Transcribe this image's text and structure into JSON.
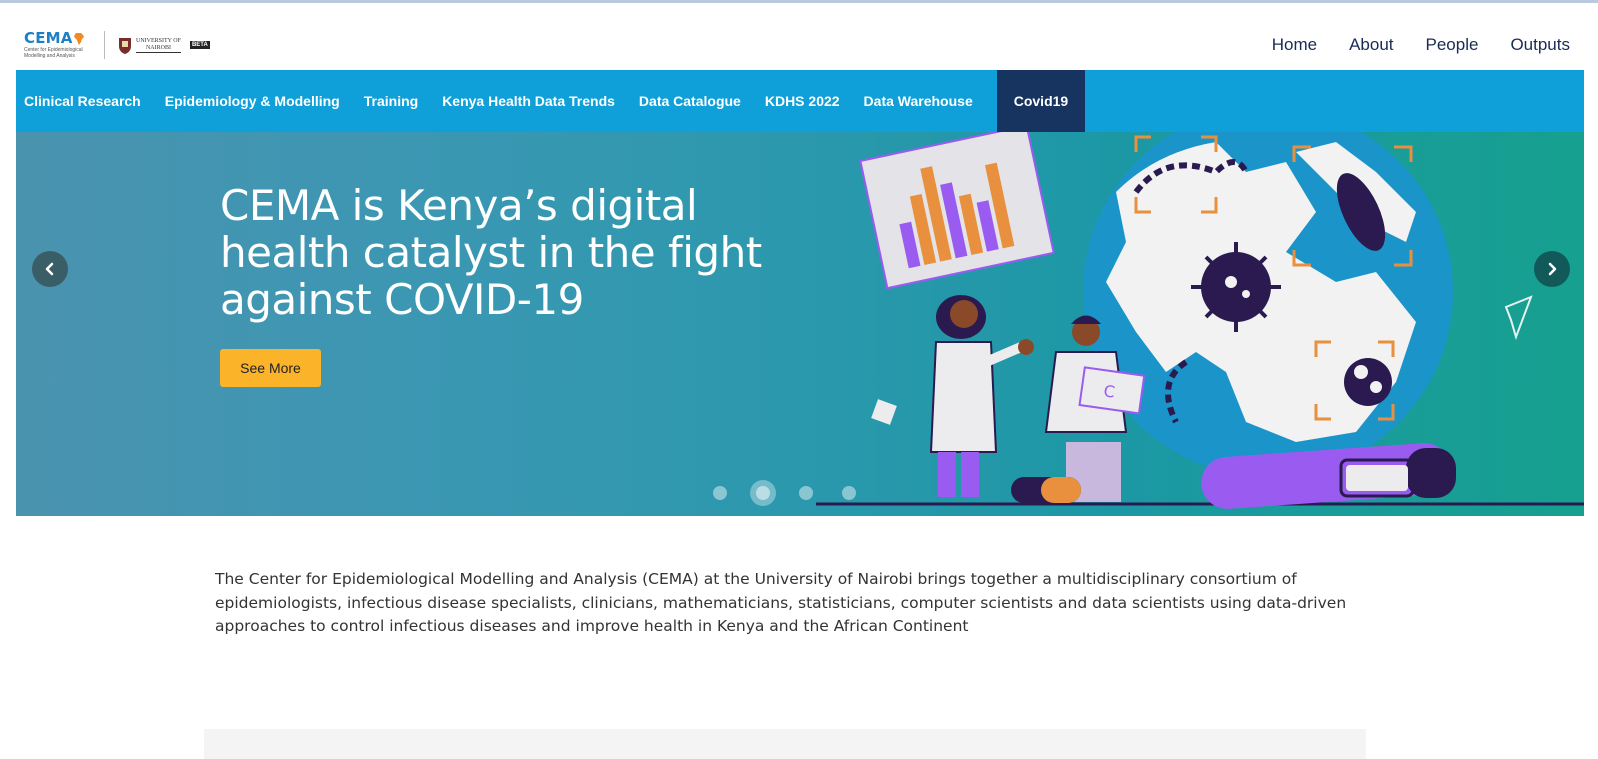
{
  "header": {
    "logo": {
      "brand": "CEMA",
      "tagline_line1": "Center for Epidemiological",
      "tagline_line2": "Modelling and Analysis",
      "partner_line1": "UNIVERSITY OF",
      "partner_line2": "NAIROBI",
      "beta_badge": "BETA"
    },
    "top_nav": [
      {
        "label": "Home"
      },
      {
        "label": "About"
      },
      {
        "label": "People"
      },
      {
        "label": "Outputs"
      }
    ]
  },
  "main_nav": {
    "items": [
      {
        "label": "Clinical Research"
      },
      {
        "label": "Epidemiology & Modelling"
      },
      {
        "label": "Training"
      },
      {
        "label": "Kenya Health Data Trends"
      },
      {
        "label": "Data Catalogue"
      },
      {
        "label": "KDHS 2022"
      },
      {
        "label": "Data Warehouse"
      },
      {
        "label": "Covid19",
        "active": true
      }
    ]
  },
  "hero": {
    "title": "CEMA is Kenya’s digital health catalyst in the fight against COVID-19",
    "button_label": "See More",
    "slide_count": 4,
    "active_slide": 2,
    "prev_icon": "chevron-left-icon",
    "next_icon": "chevron-right-icon"
  },
  "intro": {
    "text": "The Center for Epidemiological Modelling and Analysis (CEMA) at the University of Nairobi brings together a multidisciplinary consortium of epidemiologists, infectious disease specialists, clinicians, mathematicians, statisticians, computer scientists and data scientists using data-driven approaches to control infectious diseases and improve health in Kenya and the African Continent"
  },
  "colors": {
    "nav_blue": "#0fa0d9",
    "nav_active": "#17335f",
    "button_yellow": "#fbb42a",
    "text_dark": "#1a2b56"
  }
}
